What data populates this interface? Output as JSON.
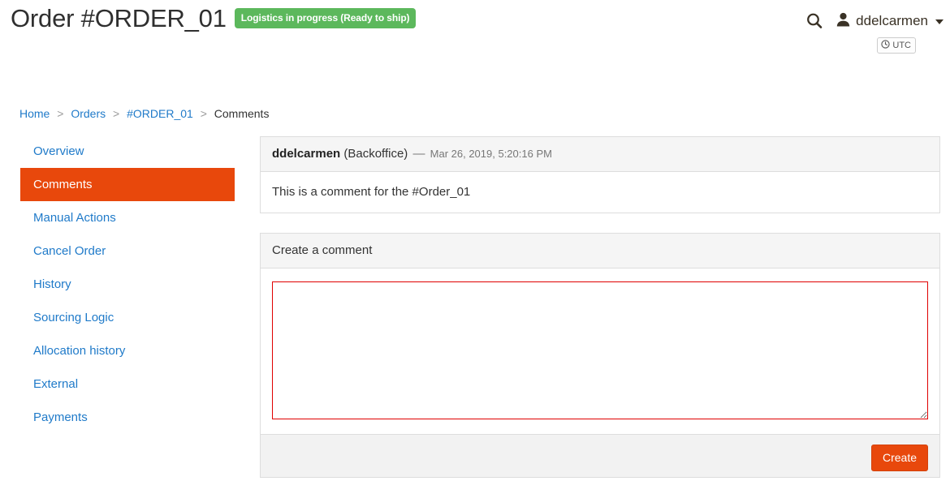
{
  "header": {
    "title": "Order #ORDER_01",
    "status_badge": "Logistics in progress (Ready to ship)",
    "status_badge_color": "#5cb85c",
    "search_icon": "search-icon",
    "user_icon": "user-icon",
    "username": "ddelcarmen",
    "timezone_badge": "UTC",
    "clock_icon": "clock-icon"
  },
  "breadcrumb": {
    "separator": ">",
    "items": [
      {
        "label": "Home",
        "current": false
      },
      {
        "label": "Orders",
        "current": false
      },
      {
        "label": "#ORDER_01",
        "current": false
      },
      {
        "label": "Comments",
        "current": true
      }
    ]
  },
  "sidebar": {
    "items": [
      {
        "label": "Overview",
        "active": false
      },
      {
        "label": "Comments",
        "active": true
      },
      {
        "label": "Manual Actions",
        "active": false
      },
      {
        "label": "Cancel Order",
        "active": false
      },
      {
        "label": "History",
        "active": false
      },
      {
        "label": "Sourcing Logic",
        "active": false
      },
      {
        "label": "Allocation history",
        "active": false
      },
      {
        "label": "External",
        "active": false
      },
      {
        "label": "Payments",
        "active": false
      }
    ],
    "active_color": "#e8480c",
    "link_color": "#1f7ac9"
  },
  "comment": {
    "author": "ddelcarmen",
    "source": "(Backoffice)",
    "dash": "—",
    "date": "Mar 26, 2019, 5:20:16 PM",
    "text": "This is a comment for the #Order_01"
  },
  "create_form": {
    "heading": "Create a comment",
    "textarea_value": "",
    "textarea_placeholder": "",
    "textarea_border_color": "#e00000",
    "submit_label": "Create",
    "submit_color": "#e8480c"
  }
}
